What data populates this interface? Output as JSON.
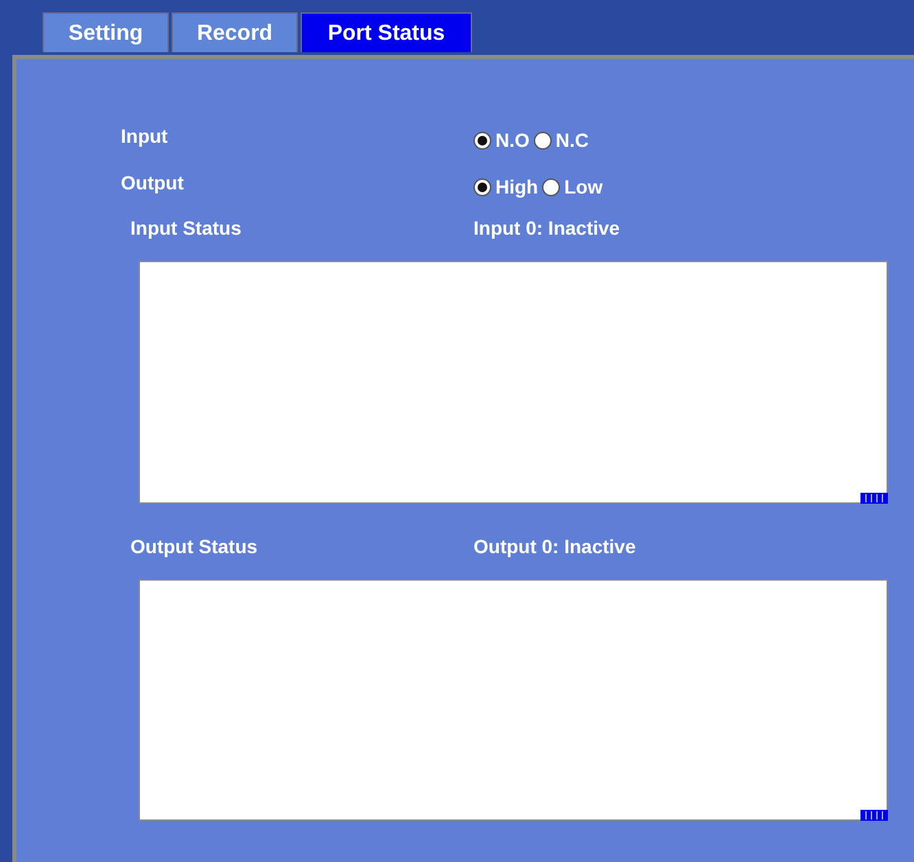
{
  "tabs": [
    {
      "label": "Setting",
      "selected": false
    },
    {
      "label": "Record",
      "selected": false
    },
    {
      "label": "Port Status",
      "selected": true
    }
  ],
  "settings": [
    {
      "label": "Input",
      "options": [
        {
          "label": "N.O",
          "selected": true
        },
        {
          "label": "N.C",
          "selected": false
        }
      ]
    },
    {
      "label": "Output",
      "options": [
        {
          "label": "High",
          "selected": true
        },
        {
          "label": "Low",
          "selected": false
        }
      ]
    }
  ],
  "status_sections": [
    {
      "label": "Input Status",
      "value": "Input 0: Inactive"
    },
    {
      "label": "Output Status",
      "value": "Output 0: Inactive"
    }
  ]
}
